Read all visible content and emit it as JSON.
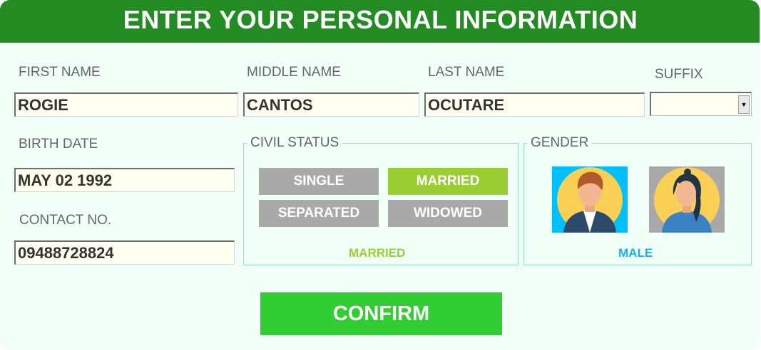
{
  "header": {
    "title": "ENTER YOUR PERSONAL INFORMATION"
  },
  "name": {
    "first_label": "FIRST NAME",
    "first_value": "ROGIE",
    "middle_label": "MIDDLE NAME",
    "middle_value": "CANTOS",
    "last_label": "LAST NAME",
    "last_value": "OCUTARE",
    "suffix_label": "SUFFIX",
    "suffix_value": ""
  },
  "birth": {
    "label": "BIRTH DATE",
    "value": "MAY 02 1992"
  },
  "contact": {
    "label": "CONTACT NO.",
    "value": "09488728824"
  },
  "civil_status": {
    "legend": "CIVIL STATUS",
    "options": [
      "SINGLE",
      "MARRIED",
      "SEPARATED",
      "WIDOWED"
    ],
    "selected": "MARRIED",
    "selected_color": "#9acd32",
    "unselected_color": "#a9a9a9"
  },
  "gender": {
    "legend": "GENDER",
    "options": [
      {
        "icon": "male-avatar-icon",
        "background": "#00bfff"
      },
      {
        "icon": "female-avatar-icon",
        "background": "#a9a9a9"
      }
    ],
    "selected": "MALE",
    "selected_color": "#1ab0ea"
  },
  "confirm": {
    "label": "CONFIRM",
    "color": "#32cd32"
  },
  "theme": {
    "header_bg": "#228b22",
    "panel_bg": "#f0fff7",
    "field_bg": "#fffff2"
  }
}
